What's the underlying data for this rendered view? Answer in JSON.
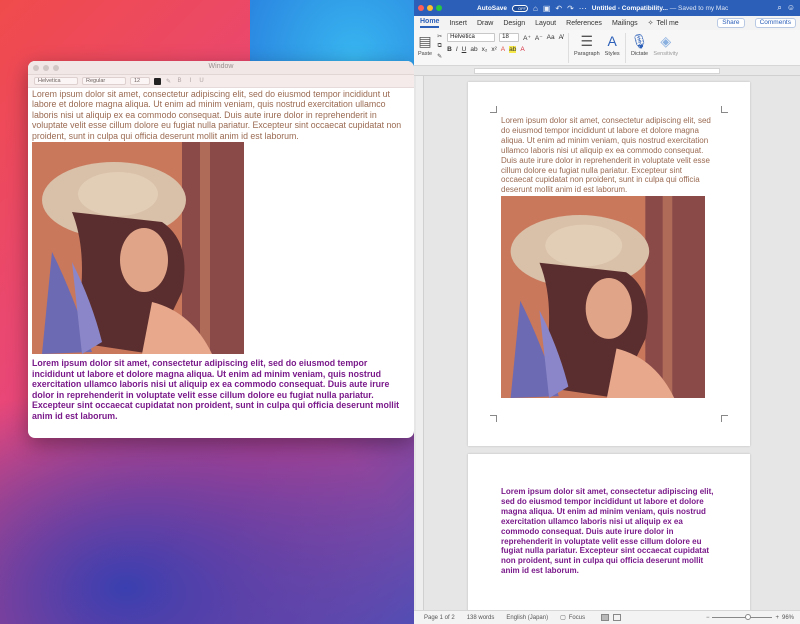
{
  "textedit": {
    "title": "Window",
    "toolbar": {
      "font": "Helvetica",
      "style": "Regular",
      "size": "12"
    },
    "paragraph1": "Lorem ipsum dolor sit amet, consectetur adipiscing elit, sed do eiusmod tempor incididunt ut labore et dolore magna aliqua. Ut enim ad minim veniam, quis nostrud exercitation ullamco laboris nisi ut aliquip ex ea commodo consequat. Duis aute irure dolor in reprehenderit in voluptate velit esse cillum dolore eu fugiat nulla pariatur. Excepteur sint occaecat cupidatat non proident, sunt in culpa qui officia deserunt mollit anim id est laborum.",
    "paragraph2": "Lorem ipsum dolor sit amet, consectetur adipiscing elit, sed do eiusmod tempor incididunt ut labore et dolore magna aliqua. Ut enim ad minim veniam, quis nostrud exercitation ullamco laboris nisi ut aliquip ex ea commodo consequat. Duis aute irure dolor in reprehenderit in voluptate velit esse cillum dolore eu fugiat nulla pariatur. Excepteur sint occaecat cupidatat non proident, sunt in culpa qui officia deserunt mollit anim id est laborum."
  },
  "word": {
    "titlebar": {
      "autosave": "AutoSave",
      "toggle": "OFF",
      "doc_title": "Untitled",
      "mode": " - Compatibility...",
      "saved": " — Saved to my Mac"
    },
    "tabs": [
      "Home",
      "Insert",
      "Draw",
      "Design",
      "Layout",
      "References",
      "Mailings"
    ],
    "tell_me": "Tell me",
    "share": "Share",
    "comments": "Comments",
    "ribbon": {
      "paste": "Paste",
      "font": "Helvetica",
      "size": "18",
      "paragraph": "Paragraph",
      "styles": "Styles",
      "dictate": "Dictate",
      "sensitivity": "Sensitivity"
    },
    "page1_text": "Lorem ipsum dolor sit amet, consectetur adipiscing elit, sed do eiusmod tempor incididunt ut labore et dolore magna aliqua. Ut enim ad minim veniam, quis nostrud exercitation ullamco laboris nisi ut aliquip ex ea commodo consequat. Duis aute irure dolor in reprehenderit in voluptate velit esse cillum dolore eu fugiat nulla pariatur. Excepteur sint occaecat cupidatat non proident, sunt in culpa qui officia deserunt mollit anim id est laborum.",
    "page2_text": "Lorem ipsum dolor sit amet, consectetur adipiscing elit, sed do eiusmod tempor incididunt ut labore et dolore magna aliqua. Ut enim ad minim veniam, quis nostrud exercitation ullamco laboris nisi ut aliquip ex ea commodo consequat. Duis aute irure dolor in reprehenderit in voluptate velit esse cillum dolore eu fugiat nulla pariatur. Excepteur sint occaecat cupidatat non proident, sunt in culpa qui officia deserunt mollit anim id est laborum.",
    "status": {
      "page": "Page 1 of 2",
      "words": "138 words",
      "language": "English (Japan)",
      "focus": "Focus",
      "zoom": "96%"
    }
  },
  "colors": {
    "textedit_para1": "#9a6a52",
    "textedit_para2": "#7a1a8a",
    "word_accent": "#2b5fb8"
  }
}
